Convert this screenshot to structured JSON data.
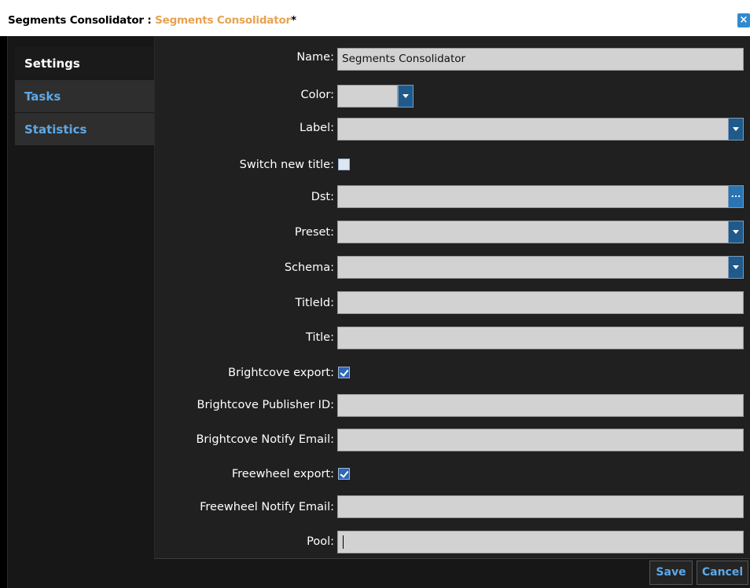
{
  "window": {
    "title_prefix": "Segments Consolidator : ",
    "title_name": "Segments Consolidator",
    "title_suffix": "*",
    "close_glyph": "×"
  },
  "sidebar": {
    "items": [
      {
        "label": "Settings",
        "active": true
      },
      {
        "label": "Tasks",
        "active": false
      },
      {
        "label": "Statistics",
        "active": false
      }
    ]
  },
  "form": {
    "name": {
      "label": "Name:",
      "value": "Segments Consolidator"
    },
    "color": {
      "label": "Color:",
      "value": ""
    },
    "label": {
      "label": "Label:",
      "value": ""
    },
    "switch_new_title": {
      "label": "Switch new title:",
      "checked": false
    },
    "dst": {
      "label": "Dst:",
      "value": "",
      "browse_glyph": "..."
    },
    "preset": {
      "label": "Preset:",
      "value": ""
    },
    "schema": {
      "label": "Schema:",
      "value": ""
    },
    "title_id": {
      "label": "TitleId:",
      "value": ""
    },
    "title": {
      "label": "Title:",
      "value": ""
    },
    "brightcove_export": {
      "label": "Brightcove export:",
      "checked": true
    },
    "brightcove_publisher_id": {
      "label": "Brightcove Publisher ID:",
      "value": ""
    },
    "brightcove_notify_email": {
      "label": "Brightcove Notify Email:",
      "value": ""
    },
    "freewheel_export": {
      "label": "Freewheel export:",
      "checked": true
    },
    "freewheel_notify_email": {
      "label": "Freewheel Notify Email:",
      "value": ""
    },
    "pool": {
      "label": "Pool:",
      "value": ""
    }
  },
  "buttons": {
    "save": "Save",
    "cancel": "Cancel"
  },
  "colors": {
    "accent": "#5ea8e6",
    "title_name": "#e8a252",
    "field_bg": "#d2d2d2",
    "panel_bg": "#202020"
  }
}
